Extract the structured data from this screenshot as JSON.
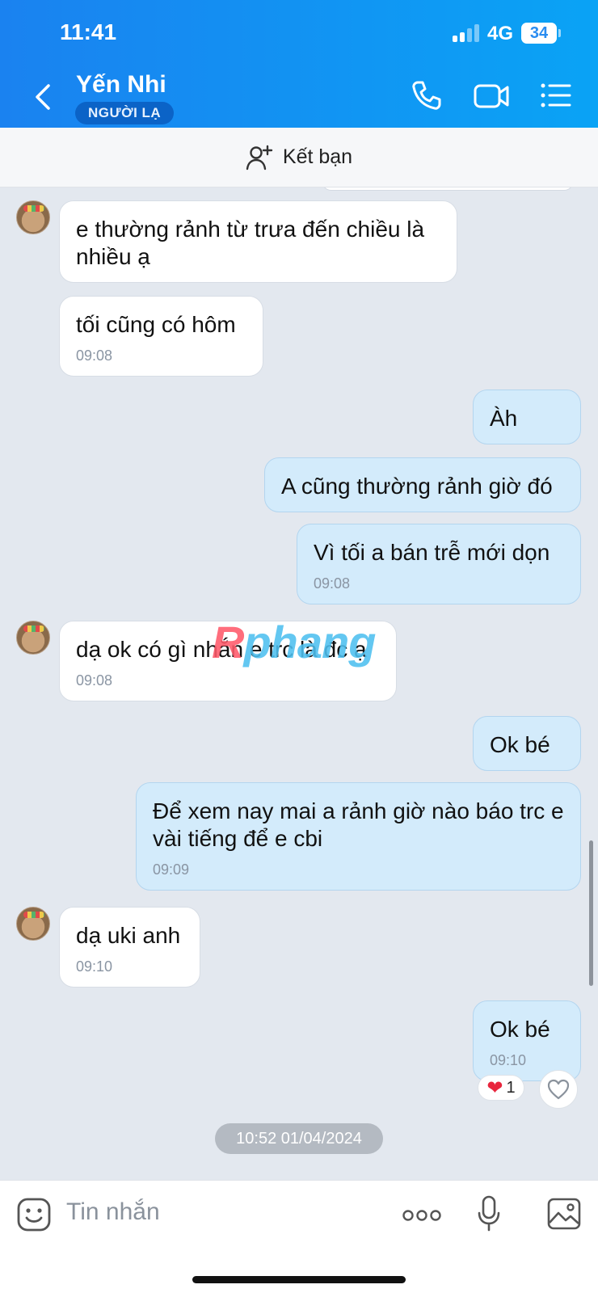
{
  "status_bar": {
    "time": "11:41",
    "network": "4G",
    "battery": "34"
  },
  "header": {
    "contact_name": "Yến Nhi",
    "badge": "NGƯỜI LẠ"
  },
  "friend_bar": {
    "label": "Kết bạn"
  },
  "messages": [
    {
      "side": "in",
      "text": "e thường rảnh từ trưa đến chiều là nhiều ạ",
      "time": ""
    },
    {
      "side": "in",
      "text": "tối cũng có hôm",
      "time": "09:08"
    },
    {
      "side": "out",
      "text": "Àh",
      "time": ""
    },
    {
      "side": "out",
      "text": "A cũng thường rảnh giờ đó",
      "time": ""
    },
    {
      "side": "out",
      "text": "Vì tối a bán trễ mới dọn",
      "time": "09:08"
    },
    {
      "side": "in",
      "text": "dạ ok có gì nhắn e trc là đc ạ",
      "time": "09:08"
    },
    {
      "side": "out",
      "text": "Ok bé",
      "time": ""
    },
    {
      "side": "out",
      "text": "Để xem nay mai a rảnh giờ nào báo trc e vài tiếng để e cbi",
      "time": "09:09"
    },
    {
      "side": "in",
      "text": "dạ uki anh",
      "time": "09:10"
    },
    {
      "side": "out",
      "text": "Ok bé",
      "time": "09:10"
    }
  ],
  "reaction": {
    "emoji": "❤",
    "count": "1"
  },
  "date_separator": "10:52 01/04/2024",
  "watermark": {
    "first": "R",
    "rest": "phang"
  },
  "composer": {
    "placeholder": "Tin nhắn"
  },
  "icons": [
    "back-icon",
    "phone-icon",
    "video-call-icon",
    "menu-icon",
    "add-friend-icon",
    "heart-icon",
    "emoji-icon",
    "more-icon",
    "microphone-icon",
    "image-icon"
  ],
  "colors": {
    "header": "#1a82f0",
    "outgoing_bubble": "#d3ebfb",
    "incoming_bubble": "#ffffff",
    "background": "#e3e8ef"
  }
}
